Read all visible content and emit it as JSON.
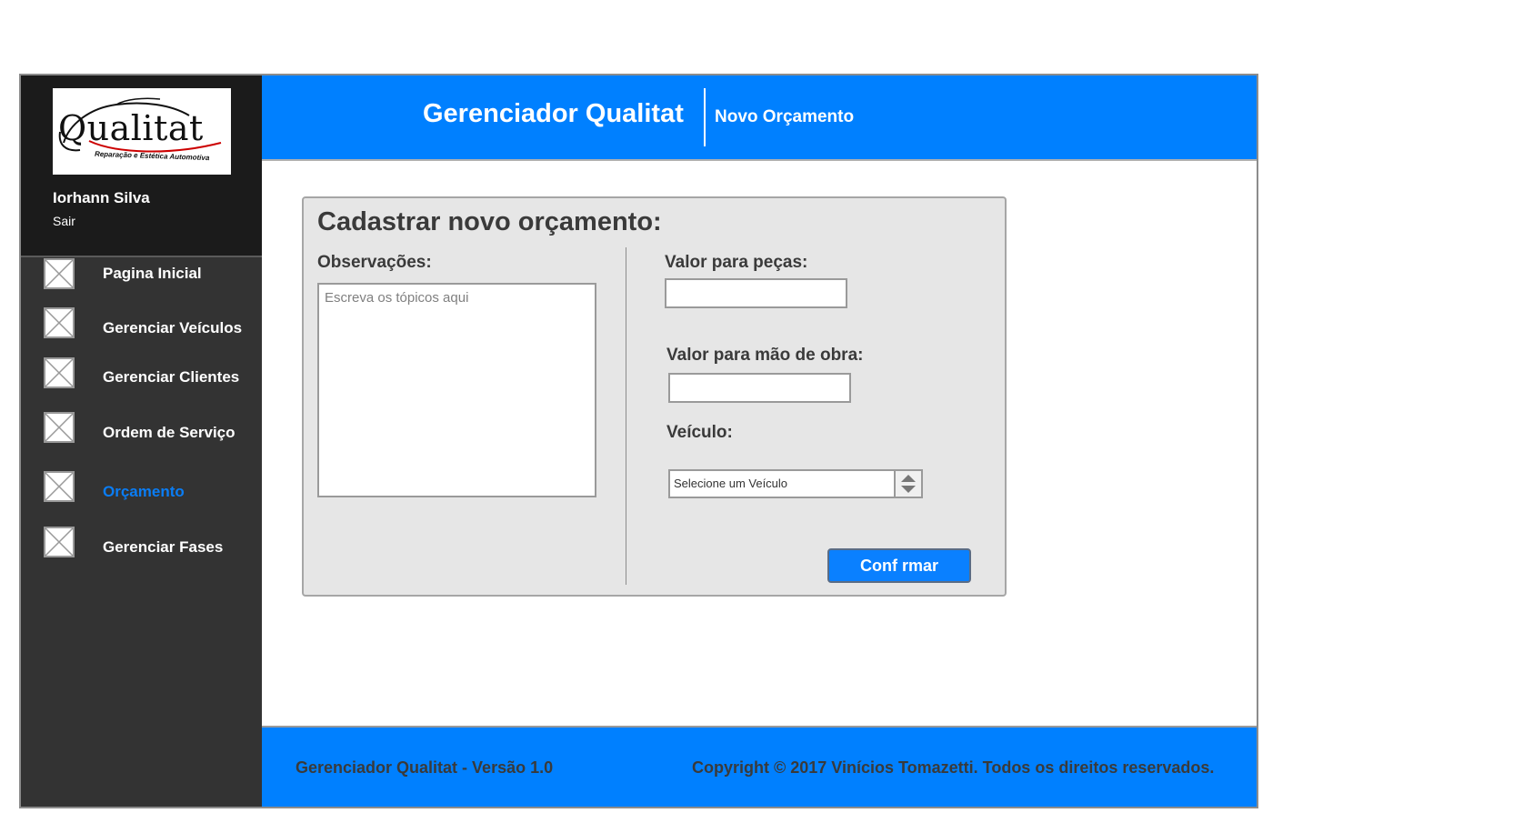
{
  "app": {
    "title": "Gerenciador Qualitat",
    "page_subtitle": "Novo Orçamento"
  },
  "logo": {
    "wordmark": "Qualitat",
    "tagline": "Reparação e Estética Automotiva"
  },
  "user": {
    "name": "Iorhann Silva",
    "logout_label": "Sair"
  },
  "sidebar": {
    "items": [
      {
        "label": "Pagina Inicial",
        "icon": "image-placeholder-icon"
      },
      {
        "label": "Gerenciar Veículos",
        "icon": "image-placeholder-icon"
      },
      {
        "label": "Gerenciar Clientes",
        "icon": "image-placeholder-icon"
      },
      {
        "label": "Ordem de Serviço",
        "icon": "image-placeholder-icon"
      },
      {
        "label": "Orçamento",
        "icon": "image-placeholder-icon",
        "active": true
      },
      {
        "label": "Gerenciar Fases",
        "icon": "image-placeholder-icon"
      }
    ]
  },
  "form": {
    "title": "Cadastrar novo orçamento:",
    "observations_label": "Observações:",
    "observations_placeholder": "Escreva os tópicos aqui",
    "observations_value": "",
    "parts_label": "Valor para peças:",
    "parts_value": "",
    "labor_label": "Valor para mão de obra:",
    "labor_value": "",
    "vehicle_label": "Veículo:",
    "vehicle_selected": "Selecione um Veículo",
    "confirm_label": "Conf rmar"
  },
  "footer": {
    "version": "Gerenciador Qualitat - Versão 1.0",
    "copyright": "Copyright © 2017 Vinícios Tomazetti. Todos os direitos reservados."
  },
  "colors": {
    "brand_blue": "#0080ff",
    "sidebar_dark": "#333333",
    "sidebar_top": "#1b1b1b",
    "active_nav": "#0a7df5",
    "panel_bg": "#e6e6e6"
  }
}
